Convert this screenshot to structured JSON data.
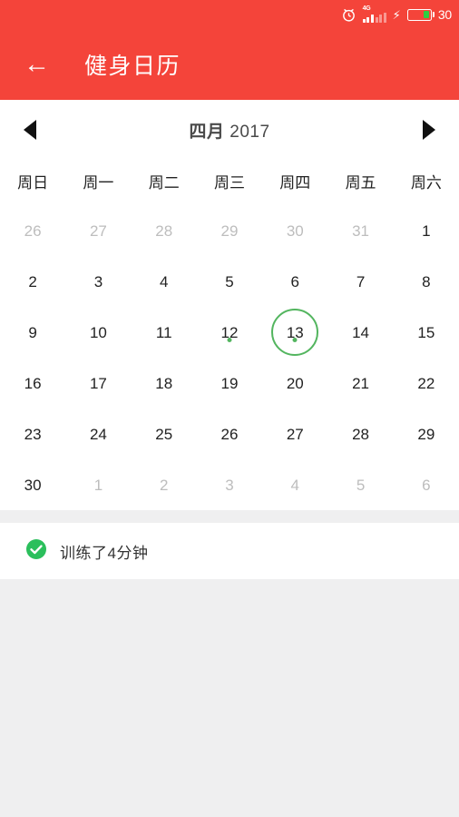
{
  "statusbar": {
    "alarm_icon": "alarm-clock-icon",
    "network_label": "4G",
    "charging_icon": "lightning-bolt-icon",
    "battery_percent": "30"
  },
  "appbar": {
    "back_icon": "←",
    "title": "健身日历"
  },
  "calendar": {
    "prev_icon": "triangle-left-icon",
    "next_icon": "triangle-right-icon",
    "month": "四月",
    "year": "2017",
    "weekdays": [
      "周日",
      "周一",
      "周二",
      "周三",
      "周四",
      "周五",
      "周六"
    ],
    "rows": [
      [
        {
          "n": "26",
          "muted": true
        },
        {
          "n": "27",
          "muted": true
        },
        {
          "n": "28",
          "muted": true
        },
        {
          "n": "29",
          "muted": true
        },
        {
          "n": "30",
          "muted": true
        },
        {
          "n": "31",
          "muted": true
        },
        {
          "n": "1",
          "muted": false
        }
      ],
      [
        {
          "n": "2",
          "muted": false
        },
        {
          "n": "3",
          "muted": false
        },
        {
          "n": "4",
          "muted": false
        },
        {
          "n": "5",
          "muted": false
        },
        {
          "n": "6",
          "muted": false
        },
        {
          "n": "7",
          "muted": false
        },
        {
          "n": "8",
          "muted": false
        }
      ],
      [
        {
          "n": "9",
          "muted": false
        },
        {
          "n": "10",
          "muted": false
        },
        {
          "n": "11",
          "muted": false
        },
        {
          "n": "12",
          "muted": false,
          "dot": true
        },
        {
          "n": "13",
          "muted": false,
          "dot": true,
          "selected": true
        },
        {
          "n": "14",
          "muted": false
        },
        {
          "n": "15",
          "muted": false
        }
      ],
      [
        {
          "n": "16",
          "muted": false
        },
        {
          "n": "17",
          "muted": false
        },
        {
          "n": "18",
          "muted": false
        },
        {
          "n": "19",
          "muted": false
        },
        {
          "n": "20",
          "muted": false
        },
        {
          "n": "21",
          "muted": false
        },
        {
          "n": "22",
          "muted": false
        }
      ],
      [
        {
          "n": "23",
          "muted": false
        },
        {
          "n": "24",
          "muted": false
        },
        {
          "n": "25",
          "muted": false
        },
        {
          "n": "26",
          "muted": false
        },
        {
          "n": "27",
          "muted": false
        },
        {
          "n": "28",
          "muted": false
        },
        {
          "n": "29",
          "muted": false
        }
      ],
      [
        {
          "n": "30",
          "muted": false
        },
        {
          "n": "1",
          "muted": true
        },
        {
          "n": "2",
          "muted": true
        },
        {
          "n": "3",
          "muted": true
        },
        {
          "n": "4",
          "muted": true
        },
        {
          "n": "5",
          "muted": true
        },
        {
          "n": "6",
          "muted": true
        }
      ]
    ]
  },
  "summary": {
    "status_icon": "check-circle-icon",
    "text": "训练了4分钟"
  },
  "colors": {
    "brand_red": "#f4443a",
    "accent_green": "#53b55f",
    "check_green": "#2bbf5c",
    "page_bg": "#efeff0",
    "card_bg": "#ffffff",
    "muted_text": "#bdbdbd"
  }
}
